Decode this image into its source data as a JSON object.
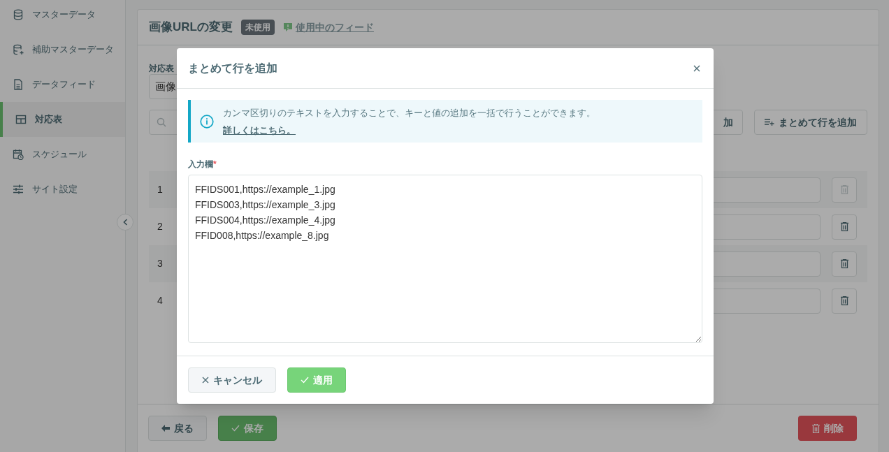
{
  "sidebar": {
    "items": [
      {
        "label": "マスターデータ",
        "selected": false
      },
      {
        "label": "補助マスターデータ",
        "selected": false
      },
      {
        "label": "データフィード",
        "selected": false
      },
      {
        "label": "対応表",
        "selected": true
      },
      {
        "label": "スケジュール",
        "selected": false
      },
      {
        "label": "サイト設定",
        "selected": false
      }
    ]
  },
  "page": {
    "title": "画像URLの変更",
    "status_badge": "未使用",
    "feed_link": "使用中のフィード",
    "name_label": "対応表",
    "name_value": "画像",
    "add_row_button": "加",
    "bulk_add_button": "まとめて行を追加",
    "rows": [
      {
        "number": "1",
        "delete_disabled": true
      },
      {
        "number": "2",
        "delete_disabled": false
      },
      {
        "number": "3",
        "delete_disabled": false
      },
      {
        "number": "4",
        "delete_disabled": false
      }
    ],
    "back_button": "戻る",
    "save_button": "保存",
    "delete_button": "削除"
  },
  "modal": {
    "title": "まとめて行を追加",
    "info_text": "カンマ区切りのテキストを入力することで、キーと値の追加を一括で行うことができます。",
    "info_link": "詳しくはこちら。",
    "field_label": "入力欄",
    "required_mark": "*",
    "lines": [
      "FFIDS001,https://example_1.jpg",
      "FFIDS003,https://example_3.jpg",
      "FFIDS004,https://example_4.jpg",
      "FFID008,https://example_8.jpg"
    ],
    "cancel_button": "キャンセル",
    "apply_button": "適用"
  }
}
